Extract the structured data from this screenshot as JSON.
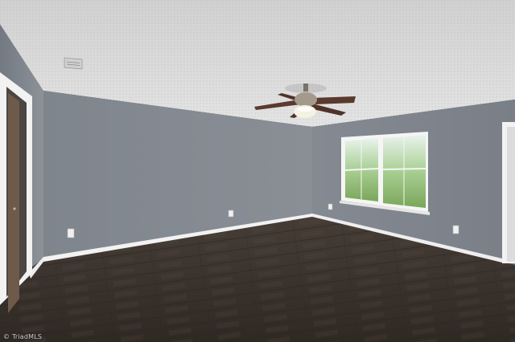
{
  "photo": {
    "watermark": "© TriadMLS",
    "colors": {
      "ceiling": "#d6d6d6",
      "wall": "#8b9097",
      "wall_shadow": "#6f747b",
      "floor": "#3b332d",
      "trim": "#f2f2f2",
      "window_glass": "#cfe6d8",
      "foliage": "#6d9b4f",
      "fan_blade": "#5a3a2e",
      "fan_light": "#f5f1e3"
    },
    "icons": {
      "ceiling_fan": "ceiling-fan-icon",
      "air_vent": "air-vent-icon",
      "outlet": "outlet-icon"
    }
  }
}
